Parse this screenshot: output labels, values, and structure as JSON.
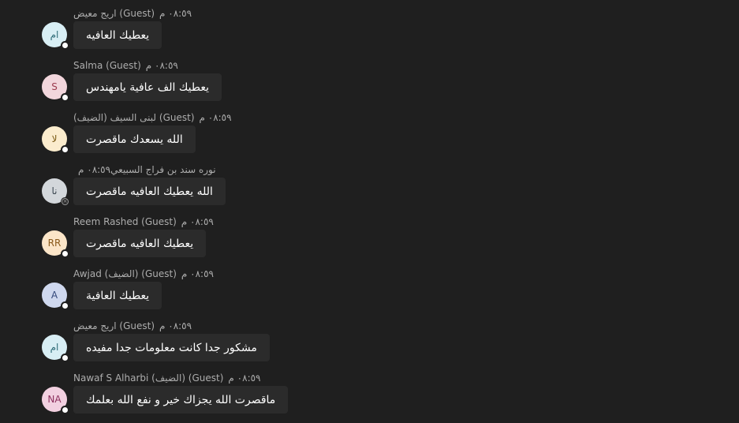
{
  "messages": [
    {
      "sender": "اريج معيض (Guest)",
      "time": "٠٨:٥٩ م",
      "text": "يعطيك العافيه",
      "avatar_initials": "ام",
      "avatar_bg": "#d8eef4",
      "avatar_fg": "#2e6b77",
      "presence": "available"
    },
    {
      "sender": "Salma (Guest)",
      "time": "٠٨:٥٩ م",
      "text": "يعطيك الف عافية يامهندس",
      "avatar_initials": "S",
      "avatar_bg": "#f2d6dc",
      "avatar_fg": "#9b3a4d",
      "presence": "available"
    },
    {
      "sender": "لبنى السيف (الضيف) (Guest)",
      "time": "٠٨:٥٩ م",
      "text": "الله يسعدك ماقصرت",
      "avatar_initials": "لا",
      "avatar_bg": "#fbeccd",
      "avatar_fg": "#7a5a14",
      "presence": "available"
    },
    {
      "sender": "نوره سند بن فراج السبيعي",
      "time": "٠٨:٥٩ م",
      "text": "الله يعطيك العافيه ماقصرت",
      "avatar_initials": "نا",
      "avatar_bg": "#d3d7db",
      "avatar_fg": "#3c4750",
      "presence": "offline"
    },
    {
      "sender": "Reem Rashed (Guest)",
      "time": "٠٨:٥٩ م",
      "text": "يعطيك العافيه ماقصرت",
      "avatar_initials": "RR",
      "avatar_bg": "#fbe5c8",
      "avatar_fg": "#8a5a1b",
      "presence": "available"
    },
    {
      "sender": "Awjad (الضيف) (Guest)",
      "time": "٠٨:٥٩ م",
      "text": "يعطيك العافية",
      "avatar_initials": "A",
      "avatar_bg": "#cfd8ee",
      "avatar_fg": "#34487a",
      "presence": "available"
    },
    {
      "sender": "اريج معيض (Guest)",
      "time": "٠٨:٥٩ م",
      "text": "مشكور جدا كانت معلومات جدا مفيده",
      "avatar_initials": "ام",
      "avatar_bg": "#d8eef4",
      "avatar_fg": "#2e6b77",
      "presence": "available"
    },
    {
      "sender": "Nawaf S Alharbi (الضيف) (Guest)",
      "time": "٠٨:٥٩ م",
      "text": "ماقصرت الله يجزاك خير و نفع الله بعلمك",
      "avatar_initials": "NA",
      "avatar_bg": "#f2d0e0",
      "avatar_fg": "#8b2f5c",
      "presence": "available"
    }
  ],
  "icons": {
    "offline_status": "offline-x-icon",
    "available_status": "available-dot-icon"
  }
}
